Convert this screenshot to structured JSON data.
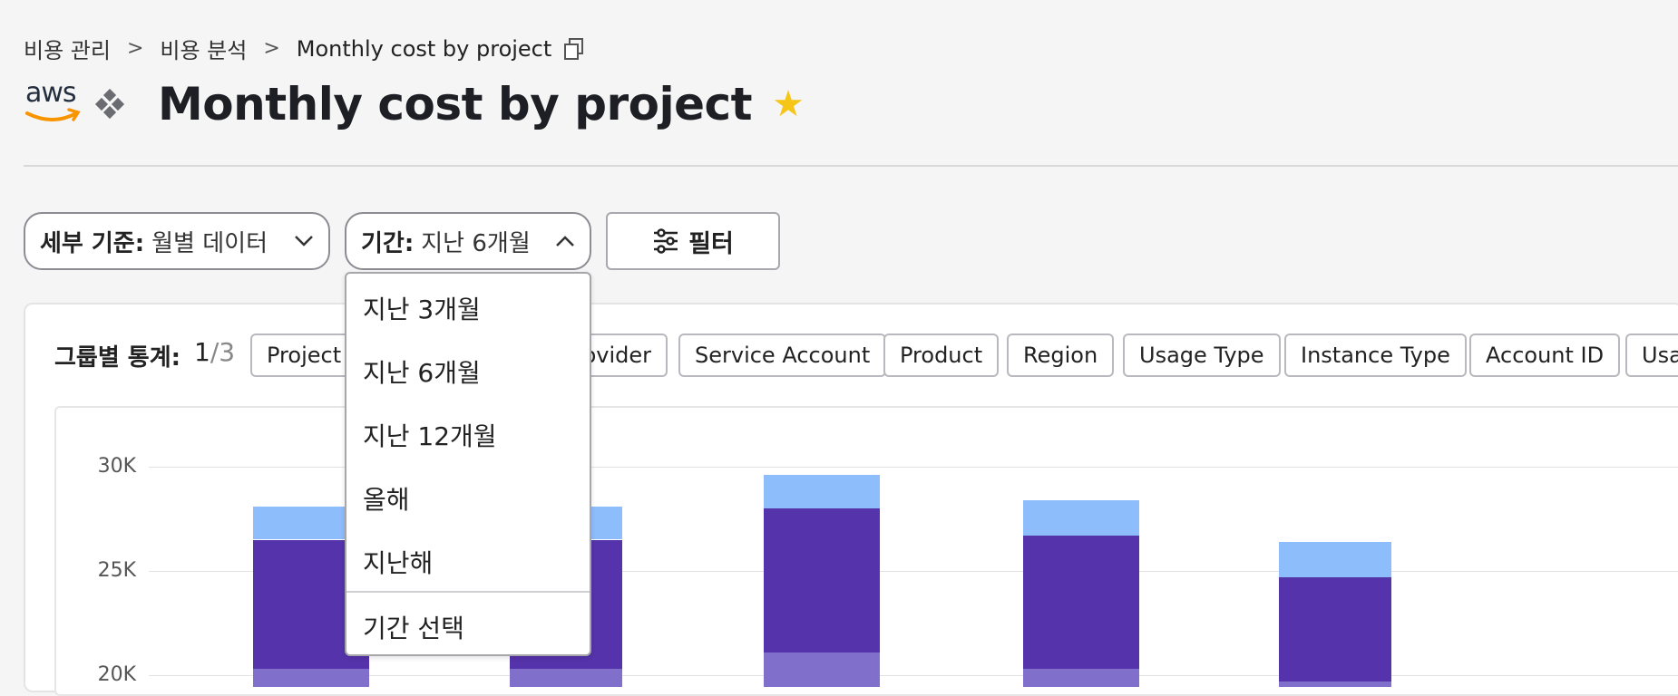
{
  "breadcrumb": {
    "items": [
      "비용 관리",
      "비용 분석"
    ],
    "current": "Monthly cost by project",
    "separator": ">"
  },
  "header": {
    "logo_text": "aws",
    "title": "Monthly cost by project",
    "favorite_star": "★"
  },
  "controls": {
    "granularity": {
      "label": "세부 기준:",
      "value": "월별 데이터",
      "chevron": "∨"
    },
    "period": {
      "label": "기간:",
      "value": "지난 6개월",
      "chevron": "∧"
    },
    "filter_label": "필터"
  },
  "period_menu": {
    "options": [
      "지난 3개월",
      "지난 6개월",
      "지난 12개월",
      "올해",
      "지난해"
    ],
    "custom": "기간 선택"
  },
  "group_stats": {
    "label": "그룹별 통계:",
    "current": "1",
    "total": "/3",
    "chips": [
      "Project",
      "Provider",
      "Service Account",
      "Product",
      "Region",
      "Usage Type",
      "Instance Type",
      "Account ID",
      "Usage"
    ]
  },
  "colors": {
    "accent_purple": "#5533aa",
    "light_blue": "#8ebdfb",
    "lavender": "#8070cc",
    "star": "#f5c518"
  },
  "chart_data": {
    "type": "bar",
    "stacked": true,
    "y_ticks": [
      "30K",
      "25K",
      "20K"
    ],
    "ylim": [
      19500,
      31000
    ],
    "categories": [
      "",
      "",
      "",
      "",
      ""
    ],
    "series": [
      {
        "color": "#8070cc",
        "values": [
          20300,
          20300,
          21100,
          20300,
          19700
        ]
      },
      {
        "color": "#5533aa",
        "values": [
          6200,
          6200,
          6900,
          6400,
          5000
        ]
      },
      {
        "color": "#8ebdfb",
        "values": [
          1600,
          1600,
          1600,
          1700,
          1700
        ]
      }
    ]
  }
}
